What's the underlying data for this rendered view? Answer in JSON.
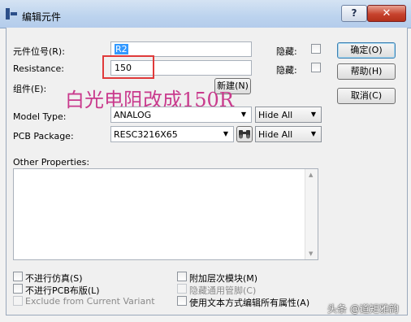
{
  "window": {
    "title": "编辑元件",
    "help_label": "?",
    "close_label": "✕"
  },
  "fields": {
    "part_ref": {
      "label": "元件位号(R):",
      "value": "R2",
      "hidden_label": "隐藏:"
    },
    "resistance": {
      "label": "Resistance:",
      "value": "150",
      "hidden_label": "隐藏:"
    },
    "component": {
      "label": "组件(E):",
      "new_button": "新建(N)"
    },
    "model_type": {
      "label": "Model Type:",
      "value": "ANALOG",
      "visibility": "Hide All"
    },
    "pcb_package": {
      "label": "PCB Package:",
      "value": "RESC3216X65",
      "visibility": "Hide All"
    },
    "other_properties": {
      "label": "Other Properties:"
    }
  },
  "buttons": {
    "ok": "确定(O)",
    "help": "帮助(H)",
    "cancel": "取消(C)"
  },
  "checkboxes": {
    "no_simulate": "不进行仿真(S)",
    "no_pcb": "不进行PCB布版(L)",
    "exclude_variant": "Exclude from Current Variant",
    "attach_hierarchy": "附加层次模块(M)",
    "hide_common_pins": "隐藏通用管脚(C)",
    "edit_text_mode": "使用文本方式编辑所有属性(A)"
  },
  "annotation": {
    "text": "白光电阻改成150R",
    "color": "#c93a8d"
  },
  "watermark": "头条 @道矩雅韵"
}
